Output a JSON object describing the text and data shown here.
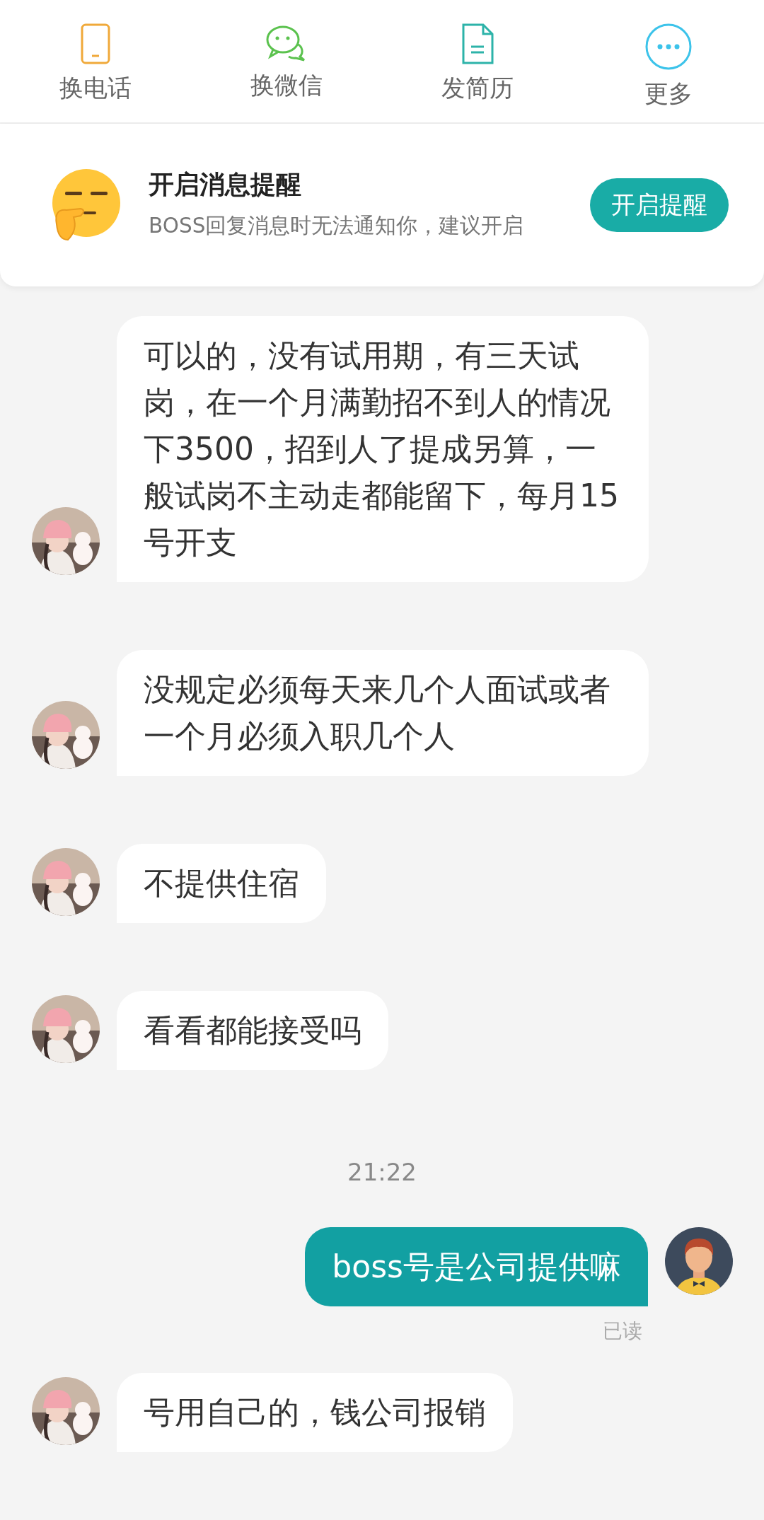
{
  "toolbar": [
    {
      "kind": "phone",
      "label": "换电话"
    },
    {
      "kind": "wechat",
      "label": "换微信"
    },
    {
      "kind": "resume",
      "label": "发简历"
    },
    {
      "kind": "more",
      "label": "更多"
    }
  ],
  "reminder": {
    "title": "开启消息提醒",
    "description": "BOSS回复消息时无法通知你，建议开启",
    "button": "开启提醒"
  },
  "messages": [
    {
      "kind": "received",
      "text": "可以的，没有试用期，有三天试岗，在一个月满勤招不到人的情况下3500，招到人了提成另算，一般试岗不主动走都能留下，每月15号开支"
    },
    {
      "kind": "received",
      "text": "没规定必须每天来几个人面试或者一个月必须入职几个人"
    },
    {
      "kind": "received",
      "text": "不提供住宿"
    },
    {
      "kind": "received",
      "text": "看看都能接受吗"
    },
    {
      "kind": "time",
      "text": "21:22"
    },
    {
      "kind": "sent",
      "text": "boss号是公司提供嘛",
      "status": "已读"
    },
    {
      "kind": "received",
      "text": "号用自己的，钱公司报销"
    }
  ]
}
